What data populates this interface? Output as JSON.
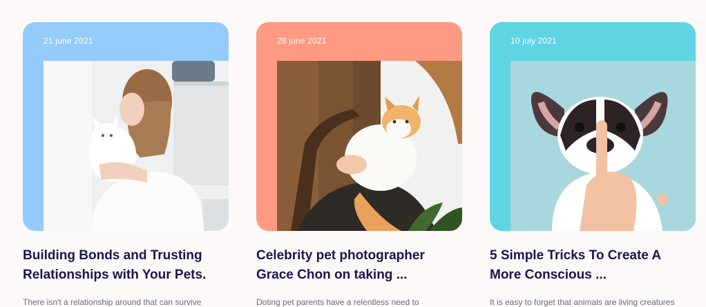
{
  "posts": [
    {
      "date": "21 june 2021",
      "title": "Building Bonds and Trusting Relationships with Your Pets.",
      "excerpt": "There isn't a relationship around that can survive",
      "accent": "#94cbfb",
      "image": "woman-hugging-white-cat-photo"
    },
    {
      "date": "28 june 2021",
      "title": "Celebrity pet photographer Grace Chon on taking ...",
      "excerpt": "Doting pet parents have a relentless need to",
      "accent": "#ff9a82",
      "image": "person-holding-orange-cat-photo"
    },
    {
      "date": "10 july 2021",
      "title": "5 Simple Tricks To Create A More Conscious ...",
      "excerpt": "It is easy to forget that animals are living creatures",
      "accent": "#5fd5e3",
      "image": "french-bulldog-shush-photo"
    }
  ]
}
